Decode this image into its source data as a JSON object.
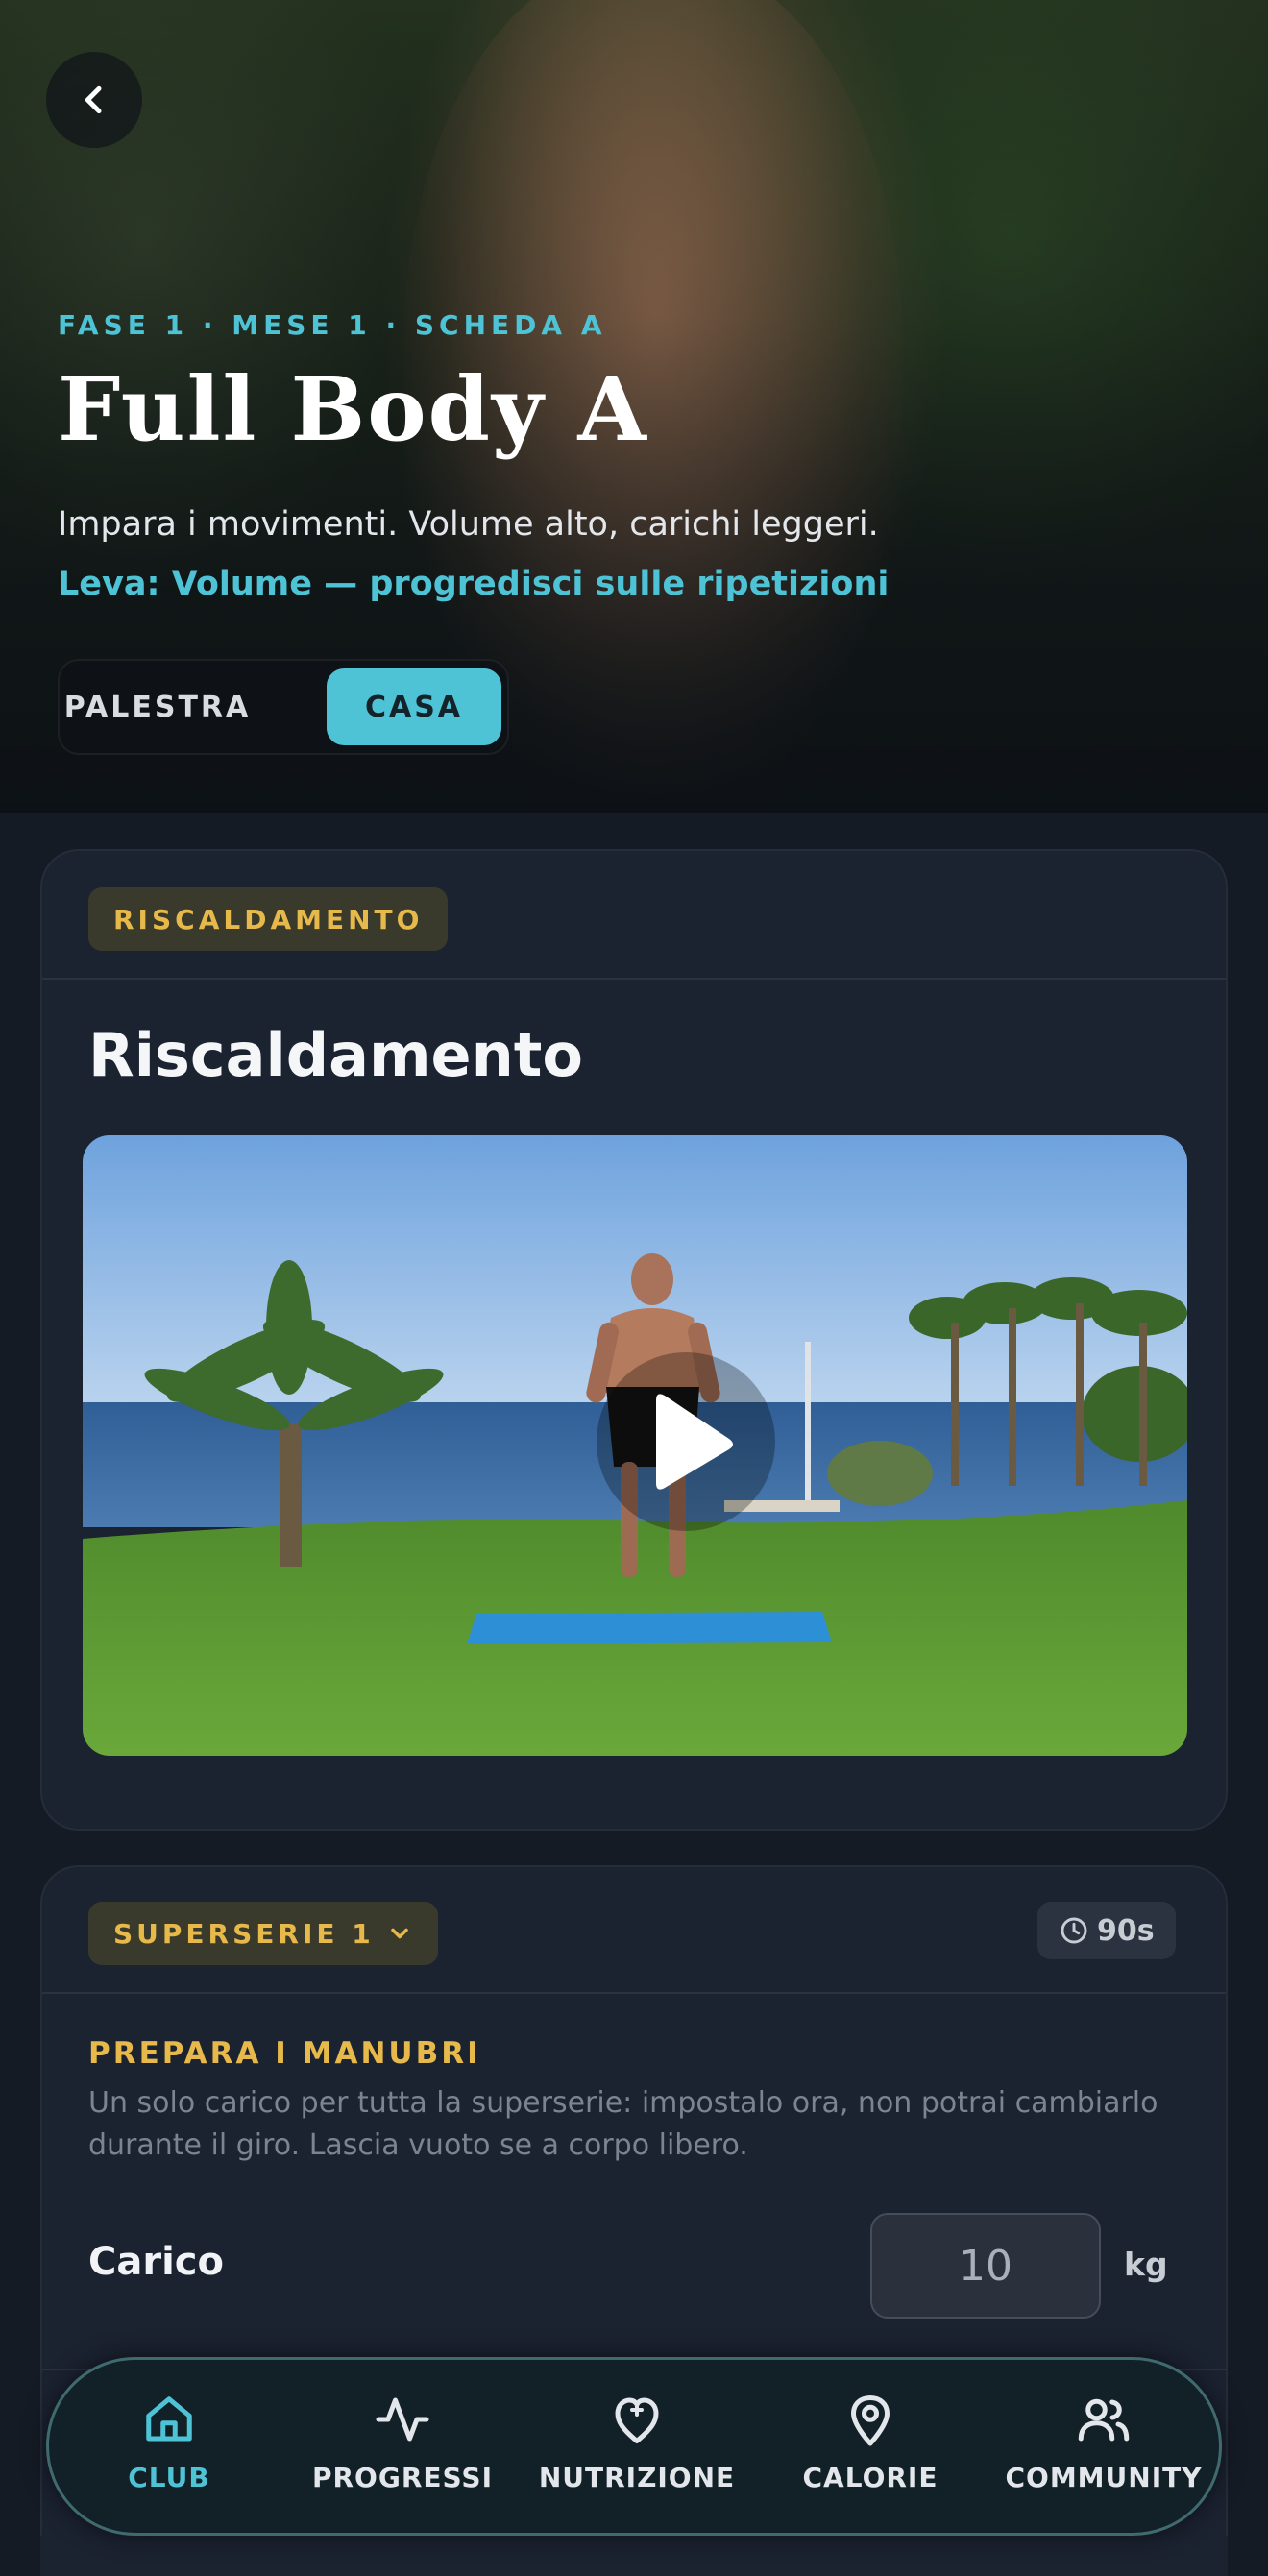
{
  "colors": {
    "accent": "#4fc3d6",
    "gold": "#e6b94a",
    "background": "#151b25",
    "card": "#1b2230"
  },
  "header": {
    "back_icon": "chevron-left-icon",
    "eyebrow": "FASE 1 · MESE 1 · SCHEDA A",
    "title": "Full Body A",
    "subtitle": "Impara i movimenti. Volume alto, carichi leggeri.",
    "lever": "Leva: Volume — progredisci sulle ripetizioni",
    "toggle": {
      "options": [
        "PALESTRA",
        "CASA"
      ],
      "selected": "CASA"
    }
  },
  "warmup": {
    "badge": "RISCALDAMENTO",
    "title": "Riscaldamento",
    "video_icon": "play-icon"
  },
  "superset": {
    "badge": "SUPERSERIE 1",
    "badge_icon": "chevron-down-icon",
    "rest": "90s",
    "rest_icon": "clock-icon",
    "prep_title": "PREPARA I MANUBRI",
    "prep_description": "Un solo carico per tutta la superserie: impostalo ora, non potrai cambiarlo durante il giro. Lascia vuoto se a corpo libero.",
    "load_label": "Carico",
    "load_value": "10",
    "load_unit": "kg"
  },
  "nav": {
    "items": [
      {
        "label": "CLUB",
        "icon": "home-icon",
        "active": true
      },
      {
        "label": "PROGRESSI",
        "icon": "activity-icon",
        "active": false
      },
      {
        "label": "NUTRIZIONE",
        "icon": "nutrition-icon",
        "active": false
      },
      {
        "label": "CALORIE",
        "icon": "map-pin-icon",
        "active": false
      },
      {
        "label": "COMMUNITY",
        "icon": "users-icon",
        "active": false
      }
    ]
  }
}
